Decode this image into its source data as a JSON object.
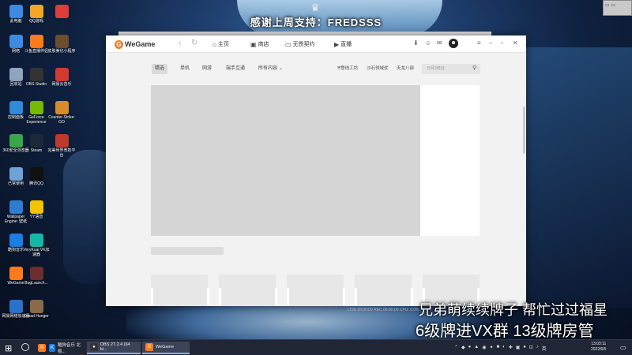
{
  "stream": {
    "banner": "感谢上周支持：FREDSSS",
    "overlay_line1": "兄弟萌续续牌子 帮忙过过福星",
    "overlay_line2": "6级牌进VX群 13级牌房管",
    "stats": "LIVE 00:00:00  REC 00:00:00  CPU: 0.0%"
  },
  "desktop_icons": [
    {
      "label": "此电脑",
      "icon": "computer-icon",
      "color": "#3c8be0"
    },
    {
      "label": "QQ游戏",
      "icon": "qq-game-icon",
      "color": "#f5a623"
    },
    {
      "label": "",
      "icon": "pdf-icon",
      "color": "#e03c3c"
    },
    {
      "label": "网络",
      "icon": "network-icon",
      "color": "#3c8be0"
    },
    {
      "label": "斗鱼直播伴侣",
      "icon": "douyu-icon",
      "color": "#ff7a1a"
    },
    {
      "label": "皮肤美化小程序",
      "icon": "tool-icon",
      "color": "#6b4e2e"
    },
    {
      "label": "回收站",
      "icon": "recycle-bin-icon",
      "color": "#8fa4bd"
    },
    {
      "label": "OBS Studio",
      "icon": "obs-icon",
      "color": "#333333"
    },
    {
      "label": "网易云音乐",
      "icon": "netease-music-icon",
      "color": "#d33a31"
    },
    {
      "label": "控制面板",
      "icon": "control-panel-icon",
      "color": "#2f8ad8"
    },
    {
      "label": "GeForce Experience",
      "icon": "nvidia-icon",
      "color": "#76b900"
    },
    {
      "label": "Counter-Strike: GO",
      "icon": "csgo-icon",
      "color": "#d98c2b"
    },
    {
      "label": "360安全浏览器",
      "icon": "browser-360-icon",
      "color": "#3aa64a"
    },
    {
      "label": "Steam",
      "icon": "steam-icon",
      "color": "#1b2838"
    },
    {
      "label": "完美世界竞技平台",
      "icon": "perfect-world-icon",
      "color": "#c0392b"
    },
    {
      "label": "已常使用",
      "icon": "document-icon",
      "color": "#6fa3d8"
    },
    {
      "label": "腾讯QQ",
      "icon": "qq-icon",
      "color": "#111111"
    },
    {
      "label": "",
      "icon": "",
      "color": ""
    },
    {
      "label": "Wallpaper Engine: 壁纸",
      "icon": "wallpaper-engine-icon",
      "color": "#2e7dd1"
    },
    {
      "label": "YY语音",
      "icon": "yy-icon",
      "color": "#f2c400"
    },
    {
      "label": "",
      "icon": "",
      "color": ""
    },
    {
      "label": "酷狗音乐",
      "icon": "kugou-icon",
      "color": "#1a7ee6"
    },
    {
      "label": "VeryKuai VK加速器",
      "icon": "verykuai-icon",
      "color": "#14b8a6"
    },
    {
      "label": "",
      "icon": "",
      "color": ""
    },
    {
      "label": "WeGame",
      "icon": "wegame-icon",
      "color": "#ff7a1a"
    },
    {
      "label": "BugLaunch...",
      "icon": "game-launcher-icon",
      "color": "#6b2d2d"
    },
    {
      "label": "",
      "icon": "",
      "color": ""
    },
    {
      "label": "网易网络加速器",
      "icon": "accelerator-icon",
      "color": "#2a72c9"
    },
    {
      "label": "Dread Hunger",
      "icon": "dread-hunger-icon",
      "color": "#8a6a48"
    }
  ],
  "wegame": {
    "logo": "WeGame",
    "nav": [
      {
        "label": "主页",
        "icon": "home-icon"
      },
      {
        "label": "商店",
        "icon": "store-icon"
      },
      {
        "label": "无畏契约",
        "icon": "game-icon"
      },
      {
        "label": "直播",
        "icon": "live-icon"
      }
    ],
    "subtabs": [
      "精选",
      "单机",
      "网游",
      "端手互通",
      "所有内容"
    ],
    "links": [
      "登线工坊",
      "沙石领域优",
      "天龙八部"
    ],
    "search_placeholder": "日月3修证",
    "avatar": "☻"
  },
  "taskbar": {
    "apps": [
      {
        "label": "",
        "icon": "douyu-icon",
        "color": "#ff7a1a"
      },
      {
        "label": "酷狗音乐 北极...",
        "icon": "kugou-icon",
        "color": "#1a7ee6"
      },
      {
        "label": "OBS 27.2.4 (64 bi...",
        "icon": "obs-icon",
        "color": "#333333"
      },
      {
        "label": "WeGame",
        "icon": "wegame-icon",
        "color": "#ff7a1a"
      }
    ],
    "time": "13:03:11",
    "date": "2022/6/5"
  },
  "colors": {
    "accent": "#ff7a1a",
    "taskbar": "#202636"
  }
}
